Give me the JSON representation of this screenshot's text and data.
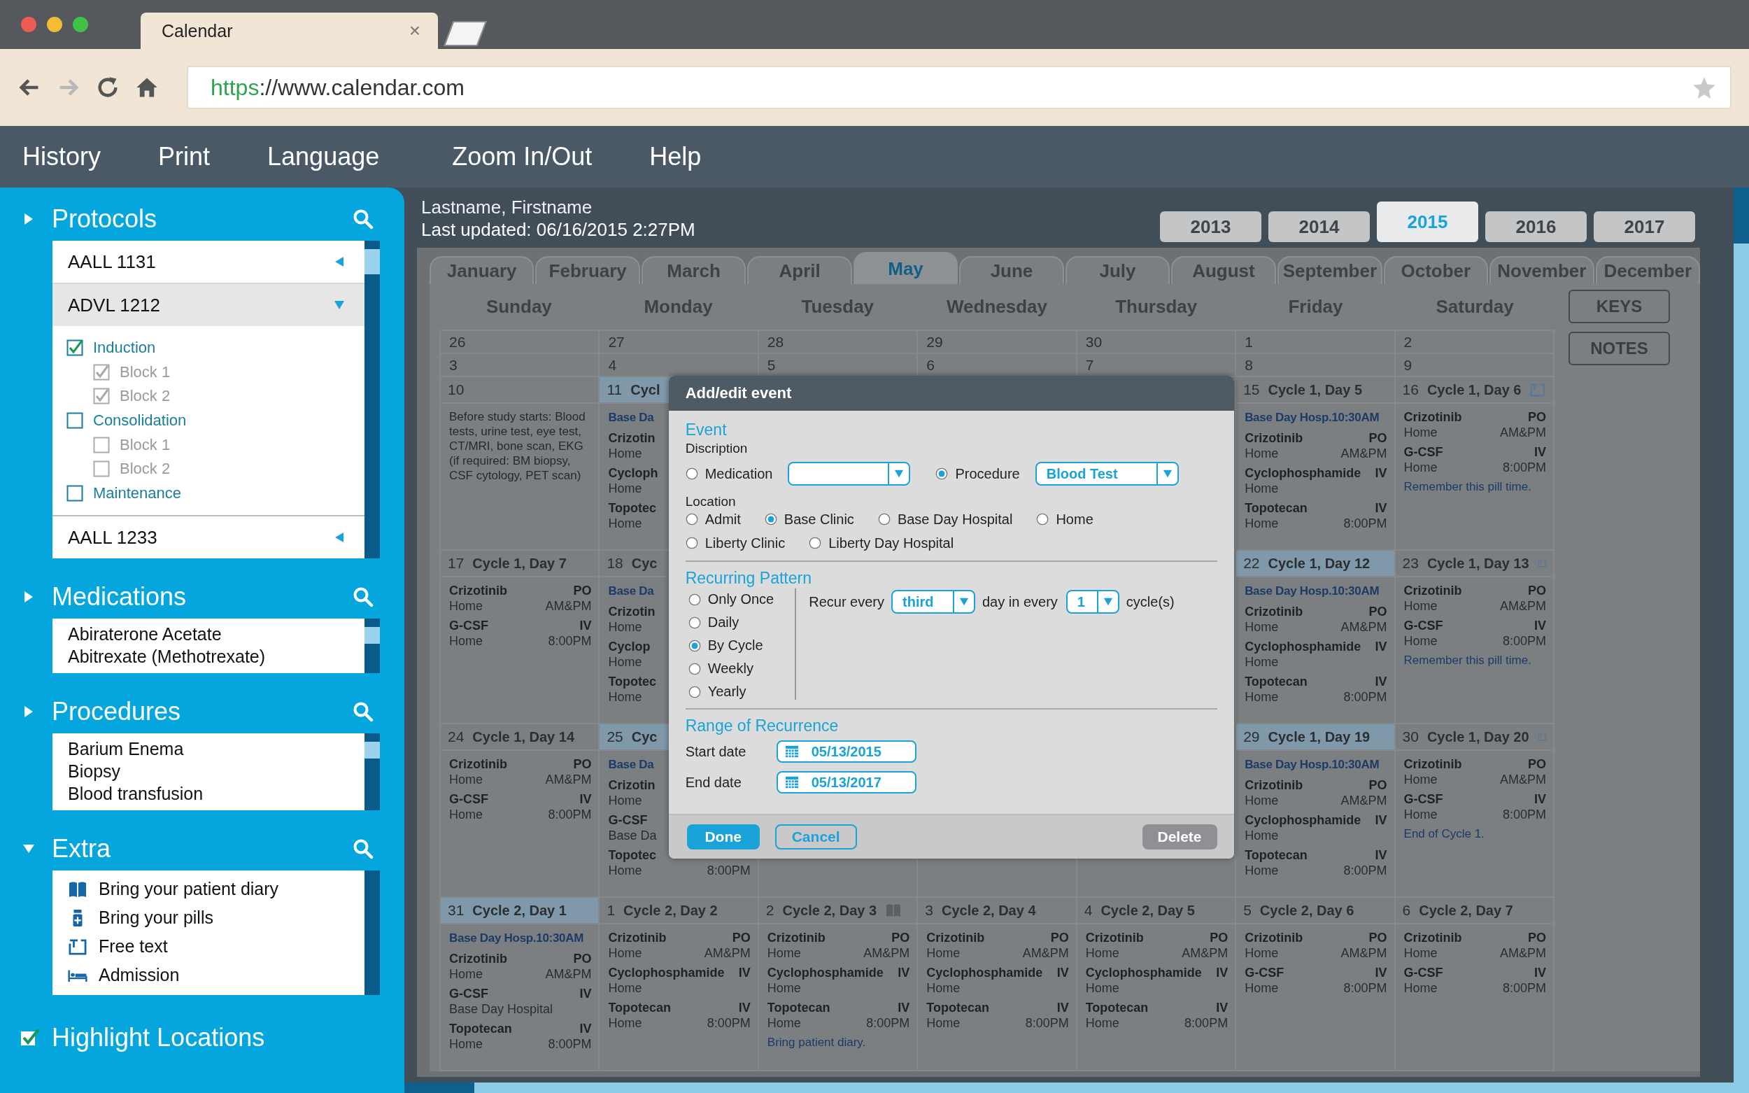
{
  "browser": {
    "tab": {
      "title": "Calendar",
      "close": "×"
    },
    "url": {
      "scheme": "https",
      "rest": "://www.calendar.com"
    }
  },
  "menu": [
    "History",
    "Print",
    "Language",
    "Zoom In/Out",
    "Help"
  ],
  "sidebar": {
    "sections": [
      {
        "kind": "protocols",
        "title": "Protocols",
        "expanded": false,
        "protocols": [
          {
            "name": "AALL 1131",
            "expanded": false
          },
          {
            "name": "ADVL 1212",
            "expanded": true,
            "children": [
              {
                "label": "Induction",
                "checked": true,
                "children": [
                  {
                    "label": "Block 1",
                    "checked": true
                  },
                  {
                    "label": "Block 2",
                    "checked": true
                  }
                ]
              },
              {
                "label": "Consolidation",
                "checked": false,
                "children": [
                  {
                    "label": "Block 1",
                    "checked": false
                  },
                  {
                    "label": "Block 2",
                    "checked": false
                  }
                ]
              },
              {
                "label": "Maintenance",
                "checked": false
              }
            ]
          },
          {
            "name": "AALL 1233",
            "expanded": false
          }
        ]
      },
      {
        "kind": "list",
        "title": "Medications",
        "expanded": false,
        "items": [
          "Abiraterone Acetate",
          "Abitrexate (Methotrexate)"
        ]
      },
      {
        "kind": "list",
        "title": "Procedures",
        "expanded": false,
        "items": [
          "Barium Enema",
          "Biopsy",
          "Blood transfusion"
        ]
      },
      {
        "kind": "extras",
        "title": "Extra",
        "expanded": true,
        "extras": [
          {
            "kind": "diary",
            "label": "Bring your patient diary"
          },
          {
            "kind": "pills",
            "label": "Bring your pills"
          },
          {
            "kind": "text",
            "label": "Free text"
          },
          {
            "kind": "admission",
            "label": "Admission"
          }
        ]
      }
    ],
    "highlight_locations": {
      "label": "Highlight Locations",
      "checked": true
    }
  },
  "patient": {
    "name": "Lastname, Firstname",
    "updated": "Last updated: 06/16/2015 2:27PM"
  },
  "years": [
    {
      "label": "2013",
      "selected": false
    },
    {
      "label": "2014",
      "selected": false
    },
    {
      "label": "2015",
      "selected": true
    },
    {
      "label": "2016",
      "selected": false
    },
    {
      "label": "2017",
      "selected": false
    }
  ],
  "months": [
    {
      "label": "January",
      "selected": false
    },
    {
      "label": "February",
      "selected": false
    },
    {
      "label": "March",
      "selected": false
    },
    {
      "label": "April",
      "selected": false
    },
    {
      "label": "May",
      "selected": true
    },
    {
      "label": "June",
      "selected": false
    },
    {
      "label": "July",
      "selected": false
    },
    {
      "label": "August",
      "selected": false
    },
    {
      "label": "September",
      "selected": false
    },
    {
      "label": "October",
      "selected": false
    },
    {
      "label": "November",
      "selected": false
    },
    {
      "label": "December",
      "selected": false
    }
  ],
  "weekdays": [
    "Sunday",
    "Monday",
    "Tuesday",
    "Wednesday",
    "Thursday",
    "Friday",
    "Saturday"
  ],
  "side_buttons": [
    "KEYS",
    "NOTES"
  ],
  "weeks": [
    {
      "kind": "short",
      "days": [
        {
          "date": "26"
        },
        {
          "date": "27"
        },
        {
          "date": "28"
        },
        {
          "date": "29"
        },
        {
          "date": "30"
        },
        {
          "date": "1"
        },
        {
          "date": "2"
        }
      ]
    },
    {
      "kind": "short",
      "days": [
        {
          "date": "3"
        },
        {
          "date": "4"
        },
        {
          "date": "5"
        },
        {
          "date": "6"
        },
        {
          "date": "7"
        },
        {
          "date": "8"
        },
        {
          "date": "9"
        }
      ]
    },
    {
      "kind": "full",
      "days": [
        {
          "kind": "day",
          "date": "10",
          "highlighted": false,
          "notes": [
            {
              "kind": "description",
              "text": "Before study starts: Blood tests, urine test, eye test, CT/MRI, bone scan, EKG (if required: BM biopsy, CSF cytology, PET scan)"
            }
          ]
        },
        {
          "kind": "day",
          "date": "11",
          "title": "Cycl",
          "highlighted": true,
          "events": [
            {
              "kind": "appointment",
              "text": "Base Da"
            },
            {
              "kind": "drug",
              "name": "Crizotin",
              "place": "Home"
            },
            {
              "kind": "drug",
              "name": "Cycloph",
              "place": "Home"
            },
            {
              "kind": "drug",
              "name": "Topotec",
              "place": "Home"
            }
          ]
        },
        {
          "kind": "covered"
        },
        {
          "kind": "covered"
        },
        {
          "kind": "covered"
        },
        {
          "kind": "day",
          "date": "15",
          "title": "Cycle 1, Day 5",
          "highlighted": false,
          "events": [
            {
              "kind": "appointment",
              "text": "Base Day Hosp.10:30AM"
            },
            {
              "kind": "drug",
              "name": "Crizotinib",
              "route": "PO",
              "place": "Home",
              "time": "AM&PM"
            },
            {
              "kind": "drug",
              "name": "Cyclophosphamide",
              "route": "IV",
              "place": "Home"
            },
            {
              "kind": "drug",
              "name": "Topotecan",
              "route": "IV",
              "place": "Home",
              "time": "8:00PM"
            }
          ]
        },
        {
          "kind": "text_day",
          "date": "16",
          "title": "Cycle 1, Day 6",
          "highlighted": false,
          "events": [
            {
              "kind": "drug",
              "name": "Crizotinib",
              "route": "PO",
              "place": "Home",
              "time": "AM&PM"
            },
            {
              "kind": "drug",
              "name": "G-CSF",
              "route": "IV",
              "place": "Home",
              "time": "8:00PM"
            }
          ],
          "notes": [
            {
              "kind": "reminder",
              "text": "Remember this pill time."
            }
          ]
        }
      ]
    },
    {
      "kind": "full",
      "days": [
        {
          "kind": "day",
          "date": "17",
          "title": "Cycle 1, Day 7",
          "highlighted": false,
          "events": [
            {
              "kind": "drug",
              "name": "Crizotinib",
              "route": "PO",
              "place": "Home",
              "time": "AM&PM"
            },
            {
              "kind": "drug",
              "name": "G-CSF",
              "route": "IV",
              "place": "Home",
              "time": "8:00PM"
            }
          ]
        },
        {
          "kind": "day",
          "date": "18",
          "title": "Cyc",
          "highlighted": false,
          "events": [
            {
              "kind": "appointment",
              "text": "Base Da"
            },
            {
              "kind": "drug",
              "name": "Crizotin",
              "place": "Home"
            },
            {
              "kind": "drug",
              "name": "Cyclop",
              "place": "Home"
            },
            {
              "kind": "drug",
              "name": "Topotec",
              "place": "Home"
            }
          ]
        },
        {
          "kind": "covered"
        },
        {
          "kind": "covered"
        },
        {
          "kind": "covered"
        },
        {
          "kind": "day",
          "date": "22",
          "title": "Cycle 1, Day 12",
          "highlighted": true,
          "events": [
            {
              "kind": "appointment",
              "text": "Base Day Hosp.10:30AM"
            },
            {
              "kind": "drug",
              "name": "Crizotinib",
              "route": "PO",
              "place": "Home",
              "time": "AM&PM"
            },
            {
              "kind": "drug",
              "name": "Cyclophosphamide",
              "route": "IV",
              "place": "Home"
            },
            {
              "kind": "drug",
              "name": "Topotecan",
              "route": "IV",
              "place": "Home",
              "time": "8:00PM"
            }
          ]
        },
        {
          "kind": "text_day",
          "date": "23",
          "title": "Cycle 1, Day 13",
          "highlighted": false,
          "events": [
            {
              "kind": "drug",
              "name": "Crizotinib",
              "route": "PO",
              "place": "Home",
              "time": "AM&PM"
            },
            {
              "kind": "drug",
              "name": "G-CSF",
              "route": "IV",
              "place": "Home",
              "time": "8:00PM"
            }
          ],
          "notes": [
            {
              "kind": "reminder",
              "text": "Remember this pill time."
            }
          ]
        }
      ]
    },
    {
      "kind": "full",
      "days": [
        {
          "kind": "day",
          "date": "24",
          "title": "Cycle 1, Day 14",
          "highlighted": false,
          "events": [
            {
              "kind": "drug",
              "name": "Crizotinib",
              "route": "PO",
              "place": "Home",
              "time": "AM&PM"
            },
            {
              "kind": "drug",
              "name": "G-CSF",
              "route": "IV",
              "place": "Home",
              "time": "8:00PM"
            }
          ]
        },
        {
          "kind": "day",
          "date": "25",
          "title": "Cyc",
          "highlighted": true,
          "events": [
            {
              "kind": "appointment",
              "text": "Base Da"
            },
            {
              "kind": "drug",
              "name": "Crizotin",
              "place": "Home"
            },
            {
              "kind": "drug",
              "name": "G-CSF",
              "place": "Base Da"
            },
            {
              "kind": "drug",
              "name": "Topotec",
              "place": "Home",
              "time": "8:00PM"
            }
          ]
        },
        {
          "kind": "blank"
        },
        {
          "kind": "blank"
        },
        {
          "kind": "blank"
        },
        {
          "kind": "day",
          "date": "29",
          "title": "Cycle 1, Day 19",
          "highlighted": true,
          "events": [
            {
              "kind": "appointment",
              "text": "Base Day Hosp.10:30AM"
            },
            {
              "kind": "drug",
              "name": "Crizotinib",
              "route": "PO",
              "place": "Home",
              "time": "AM&PM"
            },
            {
              "kind": "drug",
              "name": "Cyclophosphamide",
              "route": "IV",
              "place": "Home"
            },
            {
              "kind": "drug",
              "name": "Topotecan",
              "route": "IV",
              "place": "Home",
              "time": "8:00PM"
            }
          ]
        },
        {
          "kind": "text_day",
          "date": "30",
          "title": "Cycle 1, Day 20",
          "highlighted": false,
          "events": [
            {
              "kind": "drug",
              "name": "Crizotinib",
              "route": "PO",
              "place": "Home",
              "time": "AM&PM"
            },
            {
              "kind": "drug",
              "name": "G-CSF",
              "route": "IV",
              "place": "Home",
              "time": "8:00PM"
            }
          ],
          "notes": [
            {
              "kind": "reminder",
              "text": "End of Cycle 1."
            }
          ]
        }
      ]
    },
    {
      "kind": "full",
      "days": [
        {
          "kind": "day",
          "date": "31",
          "title": "Cycle 2, Day 1",
          "highlighted": true,
          "events": [
            {
              "kind": "appointment",
              "text": "Base Day Hosp.10:30AM"
            },
            {
              "kind": "drug",
              "name": "Crizotinib",
              "route": "PO",
              "place": "Home",
              "time": "AM&PM"
            },
            {
              "kind": "drug",
              "name": "G-CSF",
              "route": "IV",
              "place": "Base Day Hospital"
            },
            {
              "kind": "drug",
              "name": "Topotecan",
              "route": "IV",
              "place": "Home",
              "time": "8:00PM"
            }
          ]
        },
        {
          "kind": "day",
          "date": "1",
          "title": "Cycle 2, Day 2",
          "highlighted": false,
          "events": [
            {
              "kind": "drug",
              "name": "Crizotinib",
              "route": "PO",
              "place": "Home",
              "time": "AM&PM"
            },
            {
              "kind": "drug",
              "name": "Cyclophosphamide",
              "route": "IV",
              "place": "Home"
            },
            {
              "kind": "drug",
              "name": "Topotecan",
              "route": "IV",
              "place": "Home",
              "time": "8:00PM"
            }
          ]
        },
        {
          "kind": "diary_day",
          "date": "2",
          "title": "Cycle 2, Day 3",
          "highlighted": false,
          "events": [
            {
              "kind": "drug",
              "name": "Crizotinib",
              "route": "PO",
              "place": "Home",
              "time": "AM&PM"
            },
            {
              "kind": "drug",
              "name": "Cyclophosphamide",
              "route": "IV",
              "place": "Home"
            },
            {
              "kind": "drug",
              "name": "Topotecan",
              "route": "IV",
              "place": "Home",
              "time": "8:00PM"
            }
          ],
          "notes": [
            {
              "kind": "reminder",
              "text": "Bring patient diary."
            }
          ]
        },
        {
          "kind": "day",
          "date": "3",
          "title": "Cycle 2, Day 4",
          "highlighted": false,
          "events": [
            {
              "kind": "drug",
              "name": "Crizotinib",
              "route": "PO",
              "place": "Home",
              "time": "AM&PM"
            },
            {
              "kind": "drug",
              "name": "Cyclophosphamide",
              "route": "IV",
              "place": "Home"
            },
            {
              "kind": "drug",
              "name": "Topotecan",
              "route": "IV",
              "place": "Home",
              "time": "8:00PM"
            }
          ]
        },
        {
          "kind": "day",
          "date": "4",
          "title": "Cycle 2, Day 5",
          "highlighted": false,
          "events": [
            {
              "kind": "drug",
              "name": "Crizotinib",
              "route": "PO",
              "place": "Home",
              "time": "AM&PM"
            },
            {
              "kind": "drug",
              "name": "Cyclophosphamide",
              "route": "IV",
              "place": "Home"
            },
            {
              "kind": "drug",
              "name": "Topotecan",
              "route": "IV",
              "place": "Home",
              "time": "8:00PM"
            }
          ]
        },
        {
          "kind": "day",
          "date": "5",
          "title": "Cycle 2, Day 6",
          "highlighted": false,
          "events": [
            {
              "kind": "drug",
              "name": "Crizotinib",
              "route": "PO",
              "place": "Home",
              "time": "AM&PM"
            },
            {
              "kind": "drug",
              "name": "G-CSF",
              "route": "IV",
              "place": "Home",
              "time": "8:00PM"
            }
          ]
        },
        {
          "kind": "day",
          "date": "6",
          "title": "Cycle 2, Day 7",
          "highlighted": false,
          "events": [
            {
              "kind": "drug",
              "name": "Crizotinib",
              "route": "PO",
              "place": "Home",
              "time": "AM&PM"
            },
            {
              "kind": "drug",
              "name": "G-CSF",
              "route": "IV",
              "place": "Home",
              "time": "8:00PM"
            }
          ]
        }
      ]
    }
  ],
  "modal": {
    "title": "Add/edit event",
    "event": {
      "heading": "Event",
      "description_label": "Discription",
      "types": [
        {
          "label": "Medication",
          "selected": false
        },
        {
          "label": "Procedure",
          "selected": true,
          "value": "Blood Test"
        }
      ],
      "location_label": "Location",
      "locations": [
        {
          "label": "Admit",
          "selected": false
        },
        {
          "label": "Base Clinic",
          "selected": true
        },
        {
          "label": "Base Day Hospital",
          "selected": false
        },
        {
          "label": "Home",
          "selected": false
        },
        {
          "label": "Liberty Clinic",
          "selected": false
        },
        {
          "label": "Liberty Day Hospital",
          "selected": false
        }
      ]
    },
    "recurring": {
      "heading": "Recurring Pattern",
      "patterns": [
        {
          "label": "Only Once",
          "selected": false
        },
        {
          "label": "Daily",
          "selected": false
        },
        {
          "label": "By Cycle",
          "selected": true
        },
        {
          "label": "Weekly",
          "selected": false
        },
        {
          "label": "Yearly",
          "selected": false
        }
      ],
      "recur_label": "Recur every",
      "ordinal": "third",
      "middle_label": "day in every",
      "count": "1",
      "unit": "cycle(s)"
    },
    "range": {
      "heading": "Range of Recurrence",
      "dates": [
        {
          "label": "Start date",
          "value": "05/13/2015"
        },
        {
          "label": "End date",
          "value": "05/13/2017"
        }
      ]
    },
    "buttons": [
      {
        "kind": "primary",
        "label": "Done"
      },
      {
        "kind": "secondary",
        "label": "Cancel"
      },
      {
        "kind": "danger",
        "label": "Delete"
      }
    ]
  }
}
